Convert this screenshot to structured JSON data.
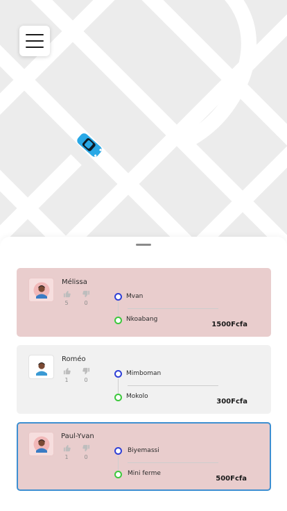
{
  "app": {
    "menu_icon": "hamburger-menu-icon",
    "map_car_icon": "taxi-car-icon"
  },
  "rides": [
    {
      "driver": "Mélissa",
      "likes": "5",
      "dislikes": "0",
      "from": "Mvan",
      "to": "Nkoabang",
      "price": "1500Fcfa",
      "background": "#e9cdcd",
      "selected": false
    },
    {
      "driver": "Roméo",
      "likes": "1",
      "dislikes": "0",
      "from": "Mimboman",
      "to": "Mokolo",
      "price": "300Fcfa",
      "background": "#f1f1f1",
      "selected": false
    },
    {
      "driver": "Paul-Yvan",
      "likes": "1",
      "dislikes": "0",
      "from": "Biyemassi",
      "to": "Mini ferme",
      "price": "500Fcfa",
      "background": "#e9cdcd",
      "selected": true
    }
  ],
  "colors": {
    "origin_dot": "#2e3fd6",
    "destination_dot": "#3dc83d",
    "selected_border": "#3d8fd1",
    "car": "#29a8e6"
  }
}
